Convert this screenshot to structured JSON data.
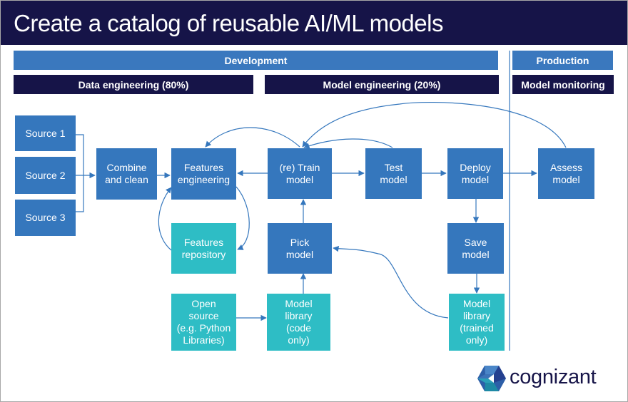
{
  "title": "Create a catalog of reusable AI/ML models",
  "phases": {
    "development": "Development",
    "production": "Production"
  },
  "sub_phases": {
    "data_engineering": "Data engineering (80%)",
    "model_engineering": "Model engineering (20%)",
    "model_monitoring": "Model monitoring"
  },
  "nodes": {
    "source1": "Source 1",
    "source2": "Source 2",
    "source3": "Source 3",
    "combine": "Combine\nand clean",
    "features_eng": "Features\nengineering",
    "features_repo": "Features\nrepository",
    "train": "(re) Train\nmodel",
    "test": "Test\nmodel",
    "deploy": "Deploy\nmodel",
    "assess": "Assess\nmodel",
    "pick": "Pick\nmodel",
    "save": "Save\nmodel",
    "open_source": "Open\nsource\n(e.g. Python\nLibraries)",
    "library_code": "Model\nlibrary\n(code\nonly)",
    "library_trained": "Model\nlibrary\n(trained\nonly)"
  },
  "colors": {
    "navy": "#161448",
    "blue": "#3577bd",
    "teal": "#2ebdc5",
    "band_blue": "#3a78be"
  },
  "logo": {
    "text": "cognizant",
    "icon": "cognizant-hexagon-logo-icon"
  }
}
